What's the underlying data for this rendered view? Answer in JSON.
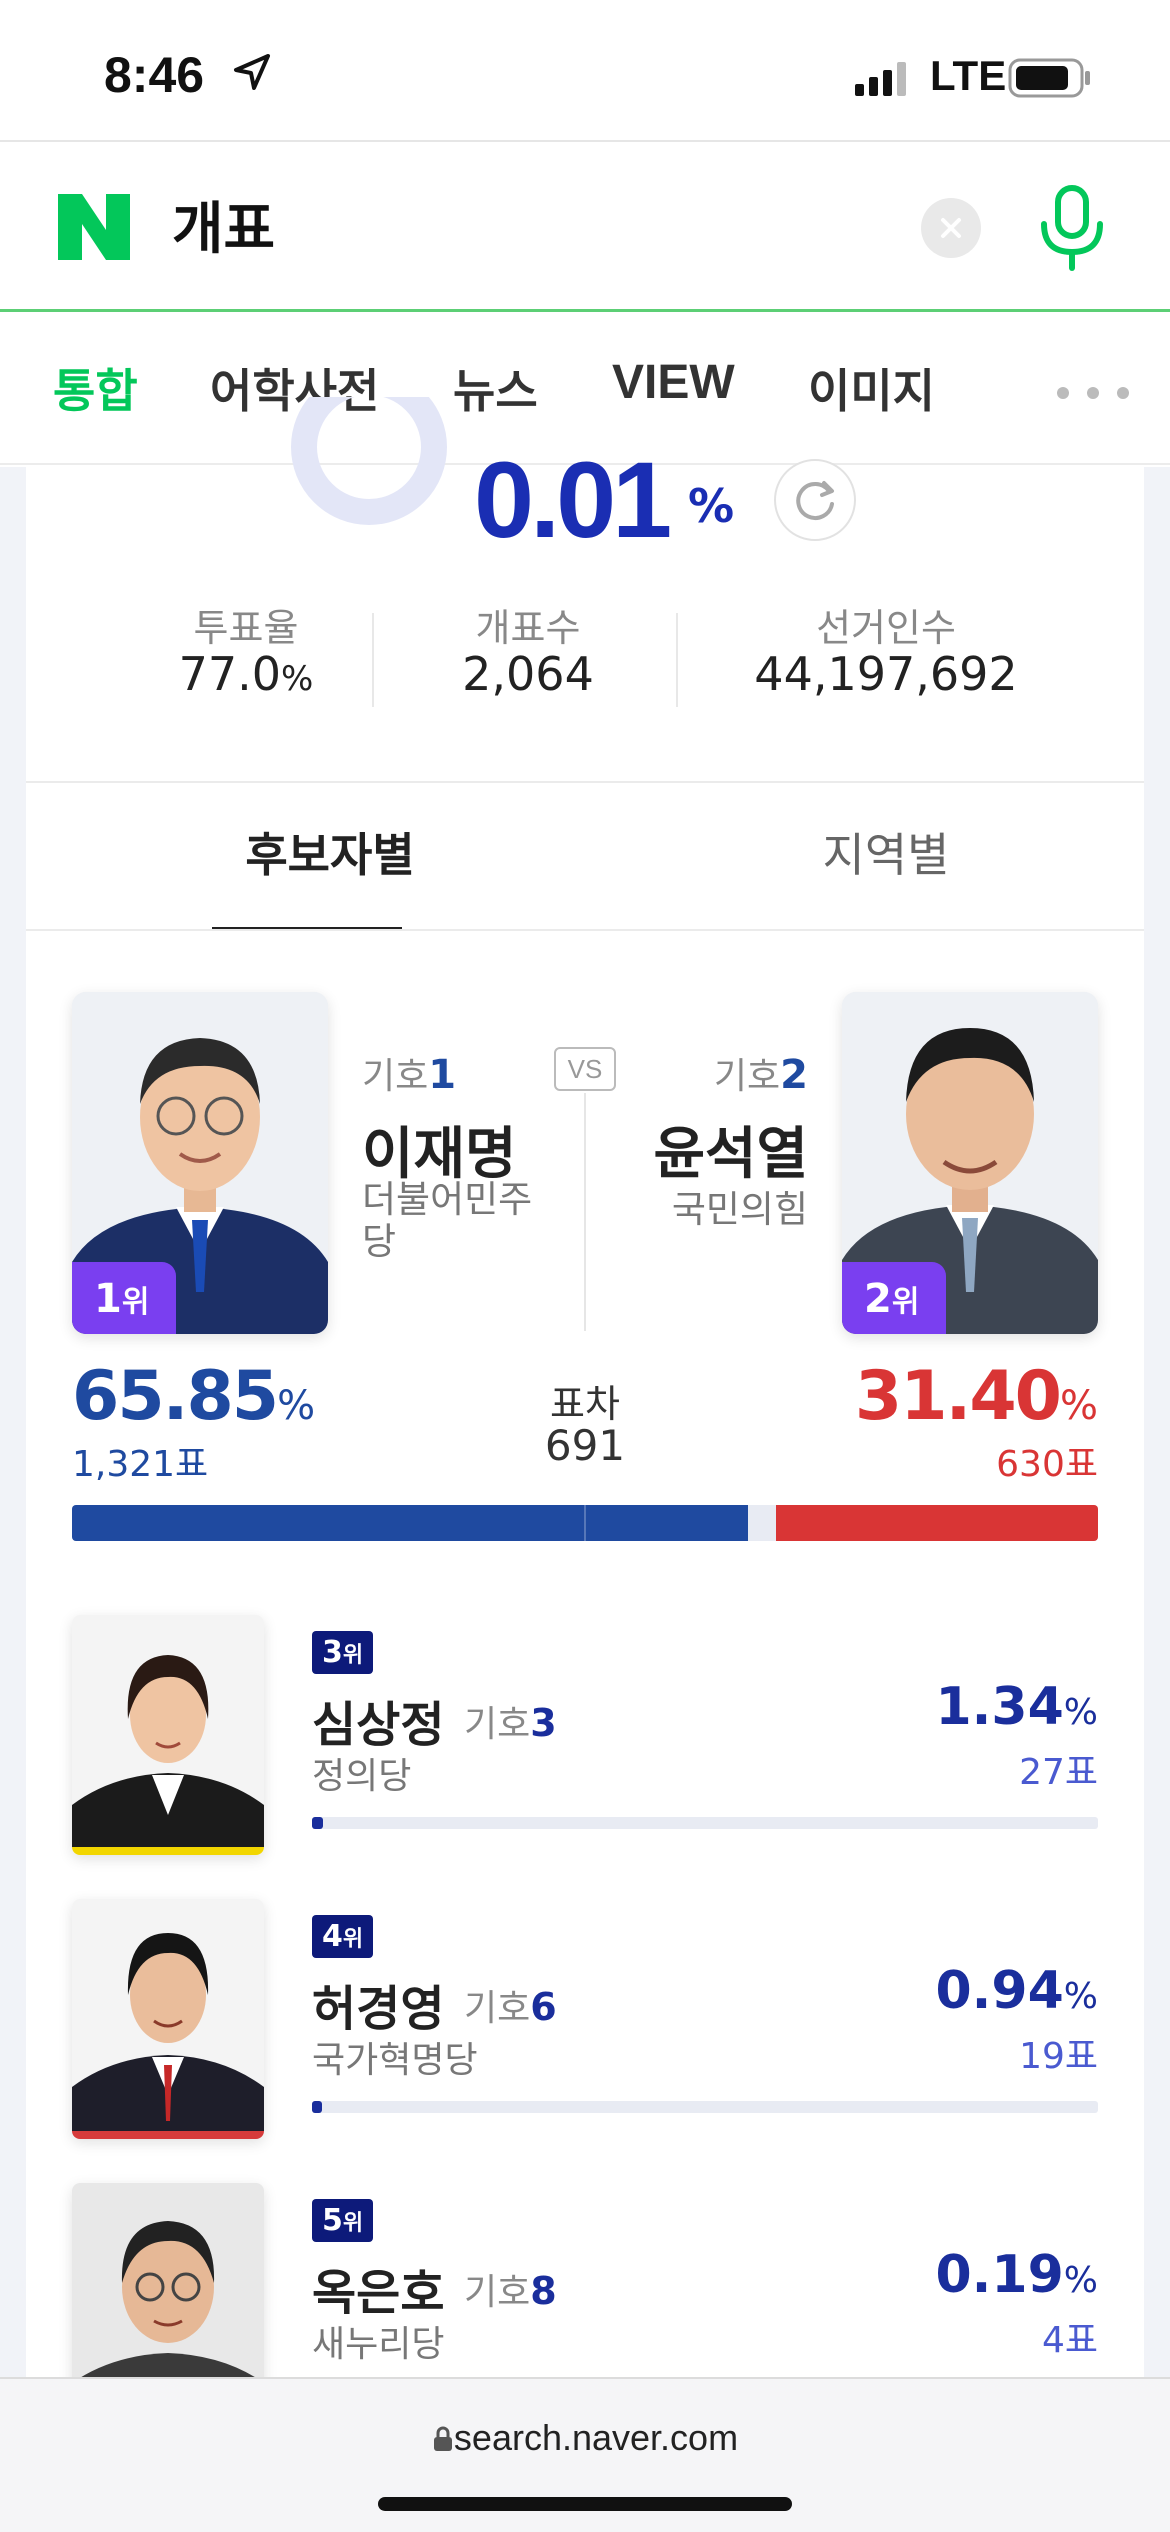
{
  "status_bar": {
    "time": "8:46",
    "network": "LTE"
  },
  "search": {
    "query": "개표"
  },
  "tabs": [
    "통합",
    "어학사전",
    "뉴스",
    "VIEW",
    "이미지"
  ],
  "summary": {
    "progress_value": "0.01",
    "progress_unit": "%",
    "turnout_label": "투표율",
    "turnout_value": "77.0",
    "turnout_unit": "%",
    "counted_label": "개표수",
    "counted_value": "2,064",
    "electorate_label": "선거인수",
    "electorate_value": "44,197,692"
  },
  "view_tabs": {
    "by_candidate": "후보자별",
    "by_region": "지역별"
  },
  "main": {
    "vs": "VS",
    "gap_label": "표차",
    "gap_value": "691",
    "left": {
      "symbol_label": "기호",
      "symbol": "1",
      "name": "이재명",
      "party": "더불어민주당",
      "rank": "1",
      "rank_suffix": "위",
      "pct": "65.85",
      "pct_unit": "%",
      "votes": "1,321표",
      "share": 0.6585
    },
    "right": {
      "symbol_label": "기호",
      "symbol": "2",
      "name": "윤석열",
      "party": "국민의힘",
      "rank": "2",
      "rank_suffix": "위",
      "pct": "31.40",
      "pct_unit": "%",
      "votes": "630표",
      "share": 0.314
    }
  },
  "minor_candidates": [
    {
      "rank": "3",
      "rank_suffix": "위",
      "name": "심상정",
      "symbol_label": "기호",
      "symbol": "3",
      "party": "정의당",
      "pct": "1.34",
      "pct_unit": "%",
      "votes": "27표",
      "share": 0.0134,
      "accent": "#f2d600"
    },
    {
      "rank": "4",
      "rank_suffix": "위",
      "name": "허경영",
      "symbol_label": "기호",
      "symbol": "6",
      "party": "국가혁명당",
      "pct": "0.94",
      "pct_unit": "%",
      "votes": "19표",
      "share": 0.0094,
      "accent": "#d63b3b"
    },
    {
      "rank": "5",
      "rank_suffix": "위",
      "name": "옥은호",
      "symbol_label": "기호",
      "symbol": "8",
      "party": "새누리당",
      "pct": "0.19",
      "pct_unit": "%",
      "votes": "4표",
      "share": 0.0019,
      "accent": "#cccccc"
    }
  ],
  "colors": {
    "naver_green": "#03c75a",
    "blue": "#1f4aa0",
    "red": "#d93535",
    "navy": "#1a2e9c",
    "purple": "#7a3ff0"
  },
  "bottom": {
    "url": "search.naver.com"
  }
}
